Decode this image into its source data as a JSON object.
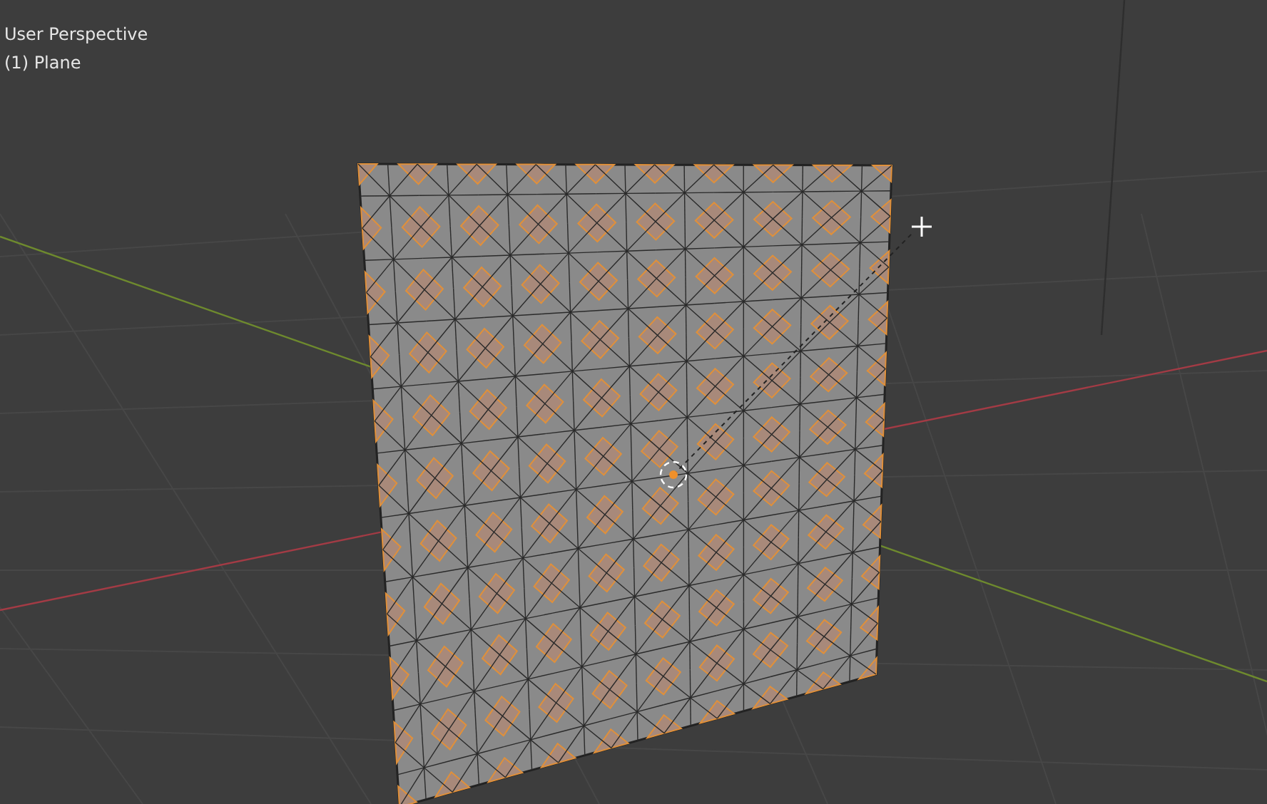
{
  "viewport": {
    "view_name": "User Perspective",
    "object_name": "(1) Plane"
  }
}
